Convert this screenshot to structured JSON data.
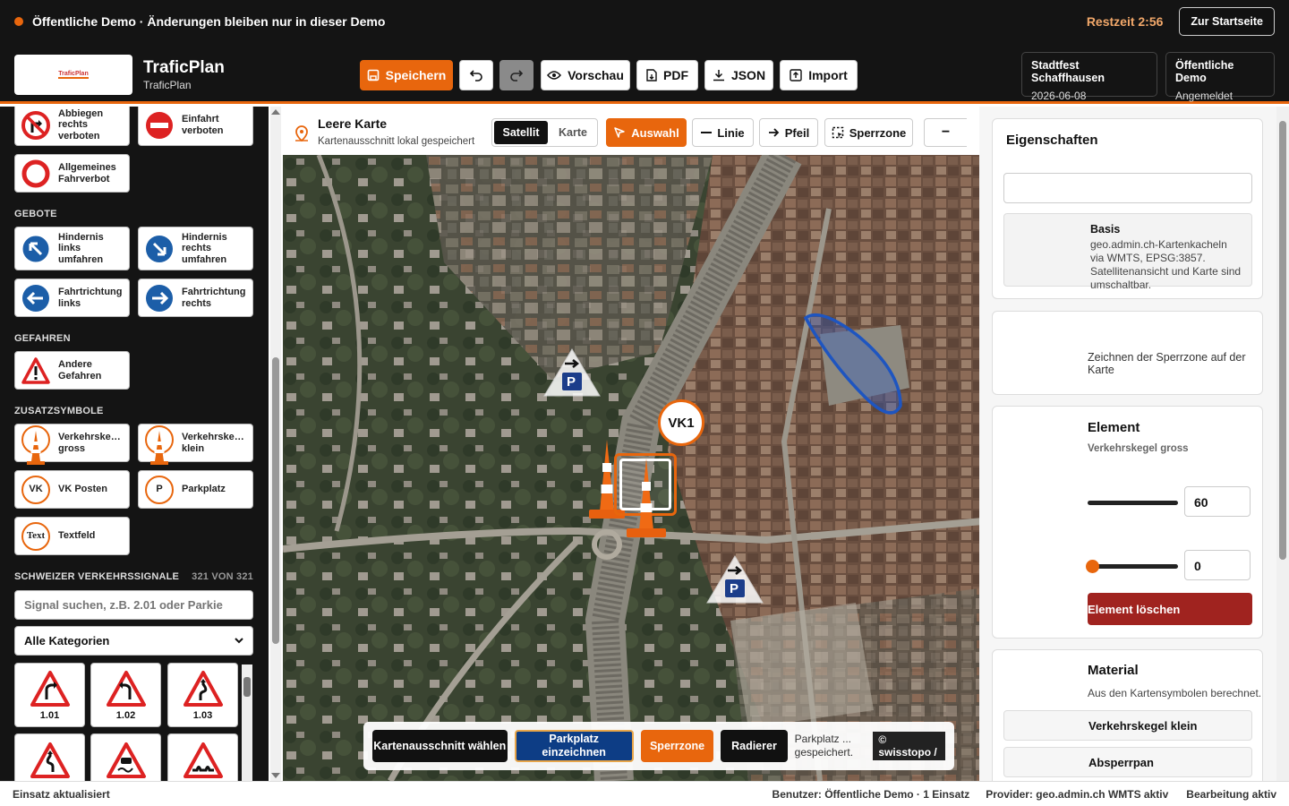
{
  "banner": {
    "message": "Öffentliche Demo · Änderungen bleiben nur in dieser Demo",
    "timer": "Restzeit 2:56",
    "home_button": "Zur Startseite"
  },
  "app": {
    "logo_text": "TraficPlan",
    "title": "TraficPlan",
    "subtitle": "TraficPlan"
  },
  "toolbar": {
    "save": "Speichern",
    "preview": "Vorschau",
    "pdf": "PDF",
    "json": "JSON",
    "import": "Import"
  },
  "event": {
    "name": "Stadtfest Schaffhausen",
    "date": "2026-06-08"
  },
  "account": {
    "mode": "Öffentliche Demo",
    "status": "Angemeldet"
  },
  "sidebar": {
    "items_top": [
      {
        "label": "Abbiegen rechts verboten",
        "icon": "no-right-turn-sign"
      },
      {
        "label": "Einfahrt verboten",
        "icon": "no-entry-sign"
      },
      {
        "label": "Allgemeines Fahrverbot",
        "icon": "no-vehicles-sign"
      }
    ],
    "section_gebote": "GEBOTE",
    "gebote": [
      {
        "label": "Hindernis links umfahren",
        "icon": "keep-left-sign"
      },
      {
        "label": "Hindernis rechts umfahren",
        "icon": "keep-right-sign"
      },
      {
        "label": "Fahrtrichtung links",
        "icon": "turn-left-sign"
      },
      {
        "label": "Fahrtrichtung rechts",
        "icon": "turn-right-sign"
      }
    ],
    "section_gefahren": "GEFAHREN",
    "gefahren": [
      {
        "label": "Andere Gefahren",
        "icon": "warning-sign"
      }
    ],
    "section_zusatz": "ZUSATZSYMBOLE",
    "zusatz": [
      {
        "label": "Verkehrske… gross",
        "icon": "traffic-cone-large"
      },
      {
        "label": "Verkehrske… klein",
        "icon": "traffic-cone-small"
      },
      {
        "label": "VK Posten",
        "badge": "VK"
      },
      {
        "label": "Parkplatz",
        "badge": "P"
      },
      {
        "label": "Textfeld",
        "badge": "Text"
      }
    ],
    "section_signals": "SCHWEIZER VERKEHRSSIGNALE",
    "signal_count": "321 VON 321",
    "search_placeholder": "Signal suchen, z.B. 2.01 oder Parkie",
    "category_select": "Alle Kategorien",
    "signals": [
      {
        "code": "1.01"
      },
      {
        "code": "1.02"
      },
      {
        "code": "1.03"
      },
      {
        "code": ""
      },
      {
        "code": ""
      },
      {
        "code": ""
      }
    ]
  },
  "map": {
    "layer_title": "Leere Karte",
    "layer_subtitle": "Kartenausschnitt lokal gespeichert",
    "view_satellite": "Satellit",
    "view_map": "Karte",
    "tool_select": "Auswahl",
    "tool_line": "Linie",
    "tool_arrow": "Pfeil",
    "tool_zone": "Sperrzone",
    "zoom_out": "−",
    "marker_vk": "VK1",
    "parking_label": "P"
  },
  "bottom": {
    "pick_area": "Kartenausschnitt wählen",
    "place_parking": "Parkplatz einzeichnen",
    "zone": "Sperrzone",
    "eraser": "Radierer",
    "hint": "Parkplatz ... gespeichert.",
    "attribution": "© swisstopo /"
  },
  "properties": {
    "title": "Eigenschaften",
    "basis_title": "Basis",
    "basis_text": "geo.admin.ch-Kartenkacheln via WMTS, EPSG:3857. Satellitenansicht und Karte sind umschaltbar.",
    "zone_text": "Zeichnen der Sperrzone auf der Karte",
    "element_title": "Element",
    "element_sub": "Verkehrskegel gross",
    "size_value": "60",
    "rotation_value": "0",
    "delete_button": "Element löschen",
    "material_title": "Material",
    "material_text": "Aus den Kartensymbolen berechnet.",
    "material_items": [
      "Verkehrskegel klein",
      "Absperrpan"
    ]
  },
  "status": {
    "left": "Einsatz aktualisiert",
    "user": "Benutzer: Öffentliche Demo · 1 Einsatz",
    "provider": "Provider: geo.admin.ch WMTS aktiv",
    "mode": "Bearbeitung aktiv"
  }
}
